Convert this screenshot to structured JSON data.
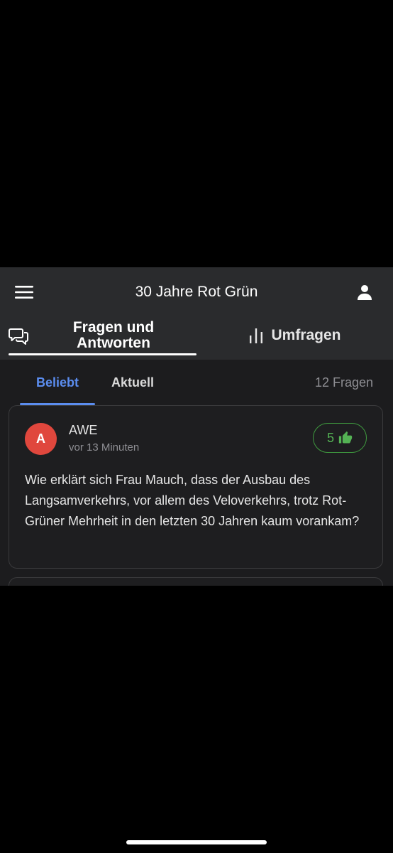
{
  "header": {
    "title": "30 Jahre Rot Grün",
    "menu_icon": "hamburger-menu-icon",
    "user_icon": "user-icon"
  },
  "tabs": [
    {
      "label": "Fragen und Antworten",
      "icon": "chat-bubbles-icon",
      "active": true
    },
    {
      "label": "Umfragen",
      "icon": "bar-chart-icon",
      "active": false
    }
  ],
  "subtabs": {
    "popular": "Beliebt",
    "recent": "Aktuell",
    "active": "popular",
    "count": "12 Fragen"
  },
  "questions": [
    {
      "avatar_letter": "A",
      "author": "AWE",
      "time": "vor 13 Minuten",
      "likes": "5",
      "text": "Wie erklärt sich Frau Mauch, dass der Ausbau des Langsamverkehrs, vor allem des Veloverkehrs, trotz Rot-Grüner Mehrheit in den letzten 30 Jahren kaum vorankam?"
    }
  ],
  "colors": {
    "accent": "#5b8def",
    "like_green": "#54b254",
    "avatar_red": "#e0473d",
    "surface": "#2a2b2d",
    "background": "#1c1c1e"
  }
}
